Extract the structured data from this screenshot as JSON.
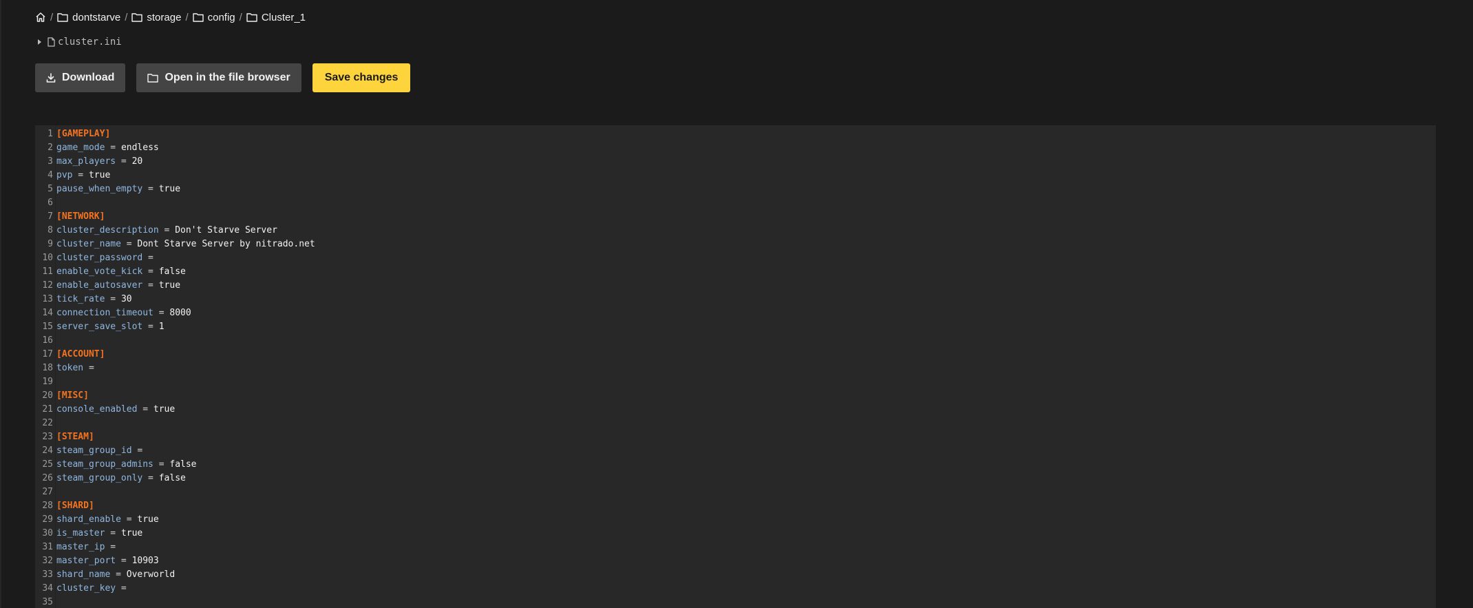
{
  "breadcrumb": {
    "items": [
      {
        "label": "dontstarve"
      },
      {
        "label": "storage"
      },
      {
        "label": "config"
      },
      {
        "label": "Cluster_1"
      }
    ],
    "separator": "/"
  },
  "file": {
    "name": "cluster.ini"
  },
  "toolbar": {
    "download_label": "Download",
    "open_browser_label": "Open in the file browser",
    "save_label": "Save changes"
  },
  "colors": {
    "background": "#1b1b1b",
    "editor_background": "#282828",
    "accent_yellow": "#fdd43c",
    "section_orange": "#f47321",
    "key_blue": "#8fb7e0"
  },
  "editor": {
    "lines": [
      {
        "n": "1",
        "section": "[GAMEPLAY]"
      },
      {
        "n": "2",
        "key": "game_mode",
        "op": " = ",
        "value": "endless"
      },
      {
        "n": "3",
        "key": "max_players",
        "op": " = ",
        "value": "20"
      },
      {
        "n": "4",
        "key": "pvp",
        "op": " = ",
        "value": "true"
      },
      {
        "n": "5",
        "key": "pause_when_empty",
        "op": " = ",
        "value": "true"
      },
      {
        "n": "6"
      },
      {
        "n": "7",
        "section": "[NETWORK]"
      },
      {
        "n": "8",
        "key": "cluster_description",
        "op": " = ",
        "value": "Don't Starve Server"
      },
      {
        "n": "9",
        "key": "cluster_name",
        "op": " = ",
        "value": "Dont Starve Server by nitrado.net"
      },
      {
        "n": "10",
        "key": "cluster_password",
        "op": " =",
        "value": ""
      },
      {
        "n": "11",
        "key": "enable_vote_kick",
        "op": " = ",
        "value": "false"
      },
      {
        "n": "12",
        "key": "enable_autosaver",
        "op": " = ",
        "value": "true"
      },
      {
        "n": "13",
        "key": "tick_rate",
        "op": " = ",
        "value": "30"
      },
      {
        "n": "14",
        "key": "connection_timeout",
        "op": " = ",
        "value": "8000"
      },
      {
        "n": "15",
        "key": "server_save_slot",
        "op": " = ",
        "value": "1"
      },
      {
        "n": "16"
      },
      {
        "n": "17",
        "section": "[ACCOUNT]"
      },
      {
        "n": "18",
        "key": "token",
        "op": " =",
        "value": ""
      },
      {
        "n": "19"
      },
      {
        "n": "20",
        "section": "[MISC]"
      },
      {
        "n": "21",
        "key": "console_enabled",
        "op": " = ",
        "value": "true"
      },
      {
        "n": "22"
      },
      {
        "n": "23",
        "section": "[STEAM]"
      },
      {
        "n": "24",
        "key": "steam_group_id",
        "op": " =",
        "value": ""
      },
      {
        "n": "25",
        "key": "steam_group_admins",
        "op": " = ",
        "value": "false"
      },
      {
        "n": "26",
        "key": "steam_group_only",
        "op": " = ",
        "value": "false"
      },
      {
        "n": "27"
      },
      {
        "n": "28",
        "section": "[SHARD]"
      },
      {
        "n": "29",
        "key": "shard_enable",
        "op": " = ",
        "value": "true"
      },
      {
        "n": "30",
        "key": "is_master",
        "op": " = ",
        "value": "true"
      },
      {
        "n": "31",
        "key": "master_ip",
        "op": " =",
        "value": ""
      },
      {
        "n": "32",
        "key": "master_port",
        "op": " = ",
        "value": "10903"
      },
      {
        "n": "33",
        "key": "shard_name",
        "op": " = ",
        "value": "Overworld"
      },
      {
        "n": "34",
        "key": "cluster_key",
        "op": " =",
        "value": ""
      },
      {
        "n": "35"
      }
    ]
  }
}
